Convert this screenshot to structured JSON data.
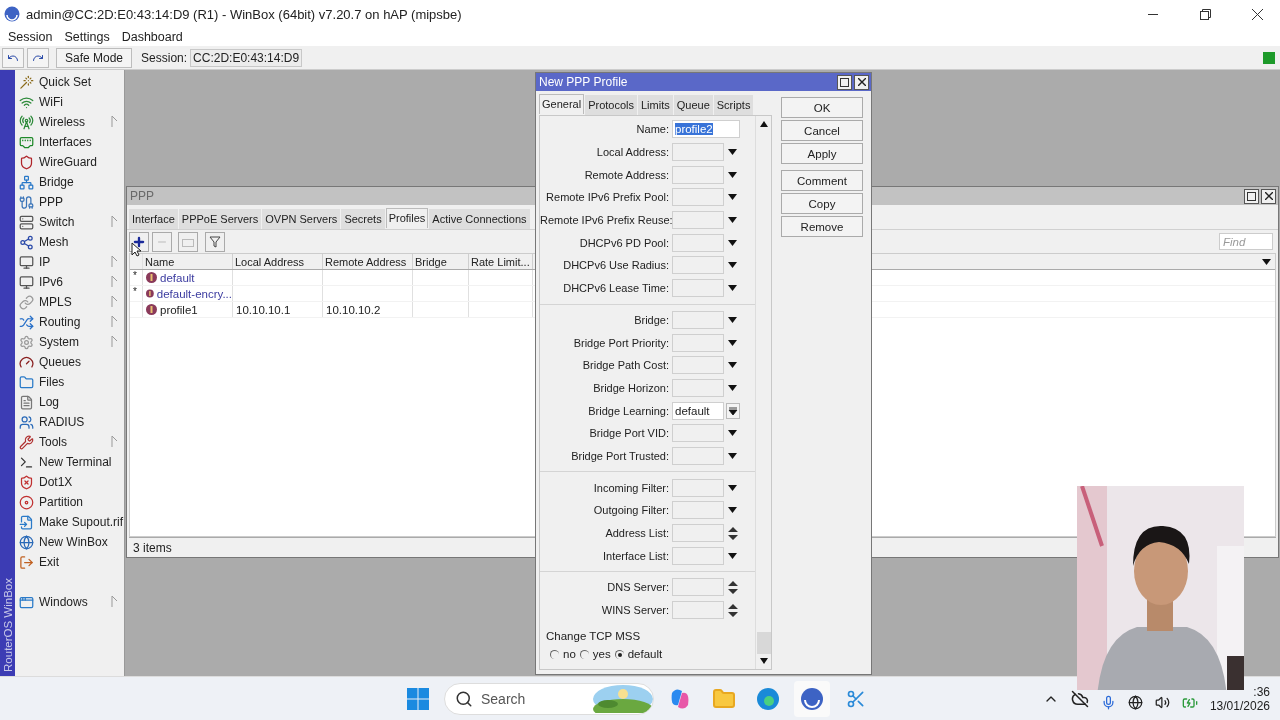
{
  "window": {
    "title": "admin@CC:2D:E0:43:14:D9 (R1) - WinBox (64bit) v7.20.7 on hAP (mipsbe)"
  },
  "menu": [
    "Session",
    "Settings",
    "Dashboard"
  ],
  "toolbar": {
    "safe_mode": "Safe Mode",
    "session_label": "Session:",
    "session_value": "CC:2D:E0:43:14:D9"
  },
  "brand": "RouterOS WinBox",
  "sidebar": {
    "items": [
      {
        "label": "Quick Set",
        "submenu": false
      },
      {
        "label": "WiFi",
        "submenu": false
      },
      {
        "label": "Wireless",
        "submenu": true
      },
      {
        "label": "Interfaces",
        "submenu": false
      },
      {
        "label": "WireGuard",
        "submenu": false
      },
      {
        "label": "Bridge",
        "submenu": false
      },
      {
        "label": "PPP",
        "submenu": false
      },
      {
        "label": "Switch",
        "submenu": true
      },
      {
        "label": "Mesh",
        "submenu": false
      },
      {
        "label": "IP",
        "submenu": true
      },
      {
        "label": "IPv6",
        "submenu": true
      },
      {
        "label": "MPLS",
        "submenu": true
      },
      {
        "label": "Routing",
        "submenu": true
      },
      {
        "label": "System",
        "submenu": true
      },
      {
        "label": "Queues",
        "submenu": false
      },
      {
        "label": "Files",
        "submenu": false
      },
      {
        "label": "Log",
        "submenu": false
      },
      {
        "label": "RADIUS",
        "submenu": false
      },
      {
        "label": "Tools",
        "submenu": true
      },
      {
        "label": "New Terminal",
        "submenu": false
      },
      {
        "label": "Dot1X",
        "submenu": false
      },
      {
        "label": "Partition",
        "submenu": false
      },
      {
        "label": "Make Supout.rif",
        "submenu": false
      },
      {
        "label": "New WinBox",
        "submenu": false
      },
      {
        "label": "Exit",
        "submenu": false
      }
    ],
    "footer_items": [
      {
        "label": "Windows",
        "submenu": true
      }
    ]
  },
  "ppp_window": {
    "title": "PPP",
    "tabs": [
      {
        "label": "Interface",
        "selected": false
      },
      {
        "label": "PPPoE Servers",
        "selected": false
      },
      {
        "label": "OVPN Servers",
        "selected": false
      },
      {
        "label": "Secrets",
        "selected": false
      },
      {
        "label": "Profiles",
        "selected": true
      },
      {
        "label": "Active Connections",
        "selected": false
      }
    ],
    "find": {
      "placeholder": "Find"
    },
    "table": {
      "columns": [
        "Name",
        "Local Address",
        "Remote Address",
        "Bridge",
        "Rate Limit..."
      ],
      "rows": [
        {
          "flag": "*",
          "builtin": true,
          "cells": [
            "default",
            "",
            "",
            "",
            ""
          ]
        },
        {
          "flag": "*",
          "builtin": true,
          "cells": [
            "default-encry...",
            "",
            "",
            "",
            ""
          ]
        },
        {
          "flag": "",
          "builtin": false,
          "cells": [
            "profile1",
            "10.10.10.1",
            "10.10.10.2",
            "",
            ""
          ]
        }
      ]
    },
    "status": "3 items"
  },
  "dialog": {
    "title": "New PPP Profile",
    "tabs": [
      {
        "label": "General",
        "selected": true
      },
      {
        "label": "Protocols",
        "selected": false
      },
      {
        "label": "Limits",
        "selected": false
      },
      {
        "label": "Queue",
        "selected": false
      },
      {
        "label": "Scripts",
        "selected": false
      }
    ],
    "groups": [
      [
        {
          "label": "Name:",
          "kind": "text",
          "value": "profile2",
          "value_selected": true
        },
        {
          "label": "Local Address:",
          "kind": "dropdown"
        },
        {
          "label": "Remote Address:",
          "kind": "dropdown"
        },
        {
          "label": "Remote IPv6 Prefix Pool:",
          "kind": "dropdown"
        },
        {
          "label": "Remote IPv6 Prefix Reuse:",
          "kind": "dropdown"
        },
        {
          "label": "DHCPv6 PD Pool:",
          "kind": "dropdown"
        },
        {
          "label": "DHCPv6 Use Radius:",
          "kind": "dropdown"
        },
        {
          "label": "DHCPv6 Lease Time:",
          "kind": "dropdown"
        }
      ],
      [
        {
          "label": "Bridge:",
          "kind": "dropdown"
        },
        {
          "label": "Bridge Port Priority:",
          "kind": "dropdown"
        },
        {
          "label": "Bridge Path Cost:",
          "kind": "dropdown"
        },
        {
          "label": "Bridge Horizon:",
          "kind": "dropdown"
        },
        {
          "label": "Bridge Learning:",
          "kind": "select",
          "value": "default"
        },
        {
          "label": "Bridge Port VID:",
          "kind": "dropdown"
        },
        {
          "label": "Bridge Port Trusted:",
          "kind": "dropdown"
        }
      ],
      [
        {
          "label": "Incoming Filter:",
          "kind": "dropdown"
        },
        {
          "label": "Outgoing Filter:",
          "kind": "dropdown"
        },
        {
          "label": "Address List:",
          "kind": "updown"
        },
        {
          "label": "Interface List:",
          "kind": "dropdown"
        }
      ],
      [
        {
          "label": "DNS Server:",
          "kind": "updown"
        },
        {
          "label": "WINS Server:",
          "kind": "updown"
        }
      ]
    ],
    "tcp_mss": {
      "title": "Change TCP MSS",
      "options": [
        {
          "label": "no",
          "selected": false
        },
        {
          "label": "yes",
          "selected": false
        },
        {
          "label": "default",
          "selected": true
        }
      ]
    },
    "buttons": [
      [
        "OK",
        "Cancel",
        "Apply"
      ],
      [
        "Comment",
        "Copy",
        "Remove"
      ]
    ]
  },
  "taskbar": {
    "search": {
      "placeholder": "Search"
    },
    "time": ":36",
    "date": "13/01/2026"
  }
}
